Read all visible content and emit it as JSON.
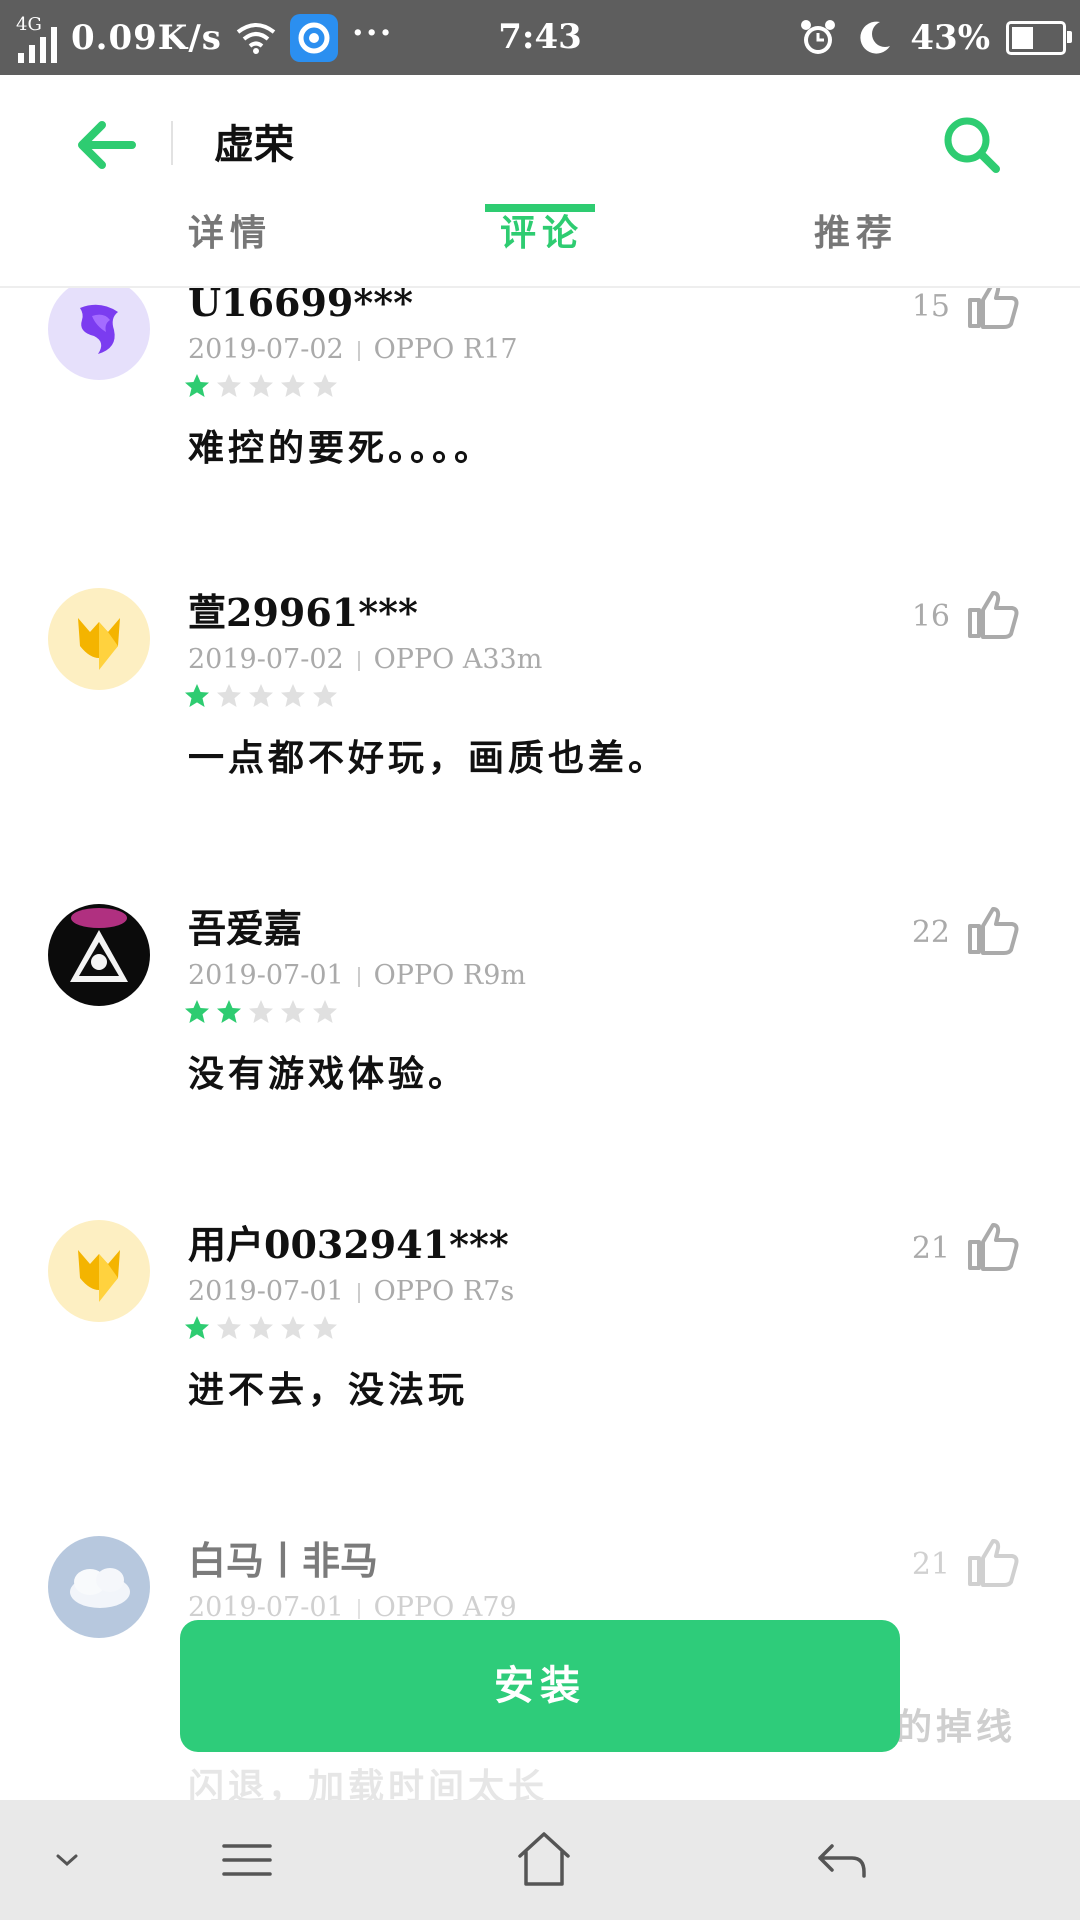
{
  "status_bar": {
    "network": "4G",
    "speed": "0.09K/s",
    "dots": "···",
    "time": "7:43",
    "battery_percent": "43%",
    "battery_level": 0.43
  },
  "header": {
    "title": "虚荣",
    "tabs": [
      {
        "label": "详情",
        "active": false
      },
      {
        "label": "评论",
        "active": true
      },
      {
        "label": "推荐",
        "active": false
      }
    ]
  },
  "comments": [
    {
      "name": "U16699***",
      "date": "2019-07-02",
      "device": "OPPO R17",
      "rating": 1,
      "text": "难控的要死。。。。",
      "likes": "15",
      "avatar": "purple-fox"
    },
    {
      "name": "萱29961***",
      "date": "2019-07-02",
      "device": "OPPO A33m",
      "rating": 1,
      "text": "一点都不好玩，画质也差。",
      "likes": "16",
      "avatar": "yellow-fox"
    },
    {
      "name": "吾爱嘉",
      "date": "2019-07-01",
      "device": "OPPO R9m",
      "rating": 2,
      "text": "没有游戏体验。",
      "likes": "22",
      "avatar": "dark-triangle"
    },
    {
      "name": "用户0032941***",
      "date": "2019-07-01",
      "device": "OPPO R7s",
      "rating": 1,
      "text": "进不去，没法玩",
      "likes": "21",
      "avatar": "yellow-fox"
    },
    {
      "name": "白马丨非马",
      "date": "2019-07-01",
      "device": "OPPO A79",
      "rating": 1,
      "text": "",
      "likes": "21",
      "avatar": "sky-cloud"
    }
  ],
  "overflow_text": {
    "line1": "的掉线",
    "line2": "闪退，加载时间太长"
  },
  "install_label": "安装",
  "colors": {
    "accent": "#2ecc71",
    "install": "#2ecc7a",
    "status_bar": "#5e5e5e",
    "star_empty": "#e0e0e0"
  }
}
